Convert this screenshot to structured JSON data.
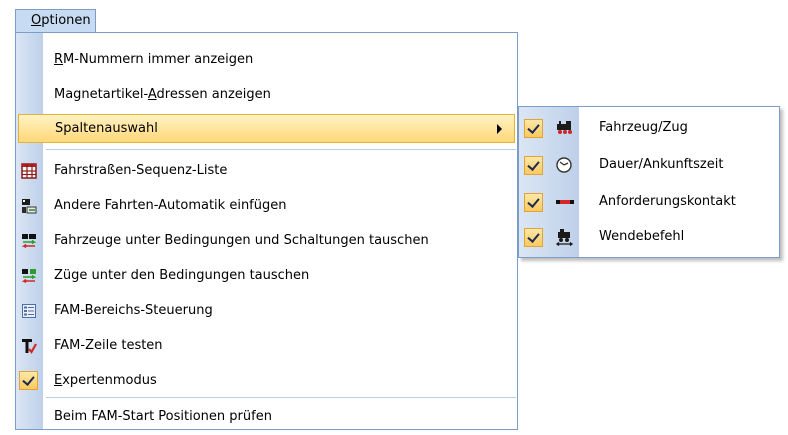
{
  "menu": {
    "title": "Optionen",
    "items": [
      {
        "label": "RM-Nummern immer anzeigen"
      },
      {
        "label": "Magnetartikel-Adressen anzeigen"
      },
      {
        "label": "Spaltenauswahl"
      },
      {
        "label": "Fahrstraßen-Sequenz-Liste",
        "icon": "grid-list-icon"
      },
      {
        "label": "Andere Fahrten-Automatik einfügen",
        "icon": "insert-automation-icon"
      },
      {
        "label": "Fahrzeuge unter Bedingungen und Schaltungen tauschen",
        "icon": "swap-vehicles-icon"
      },
      {
        "label": "Züge unter den Bedingungen tauschen",
        "icon": "swap-trains-icon"
      },
      {
        "label": "FAM-Bereichs-Steuerung",
        "icon": "area-control-icon"
      },
      {
        "label": "FAM-Zeile testen",
        "icon": "test-line-icon"
      },
      {
        "label": "Expertenmodus",
        "checked": true
      },
      {
        "label": "Beim FAM-Start Positionen prüfen"
      }
    ]
  },
  "submenu": {
    "items": [
      {
        "label": "Fahrzeug/Zug",
        "checked": true,
        "icon": "locomotive-icon"
      },
      {
        "label": "Dauer/Ankunftszeit",
        "checked": true,
        "icon": "clock-icon"
      },
      {
        "label": "Anforderungskontakt",
        "checked": true,
        "icon": "contact-bar-icon"
      },
      {
        "label": "Wendebefehl",
        "checked": true,
        "icon": "reverse-locomotive-icon"
      }
    ]
  },
  "colors": {
    "highlight": "#ffd879",
    "menu_border": "#7c9dc8",
    "gutter": "#c9d9ef"
  }
}
